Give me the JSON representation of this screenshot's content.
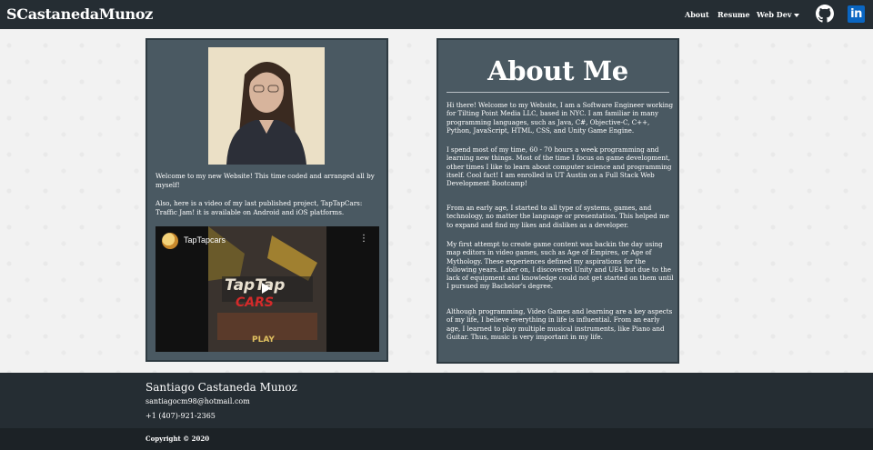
{
  "navbar": {
    "brand": "SCastanedaMunoz",
    "links": [
      "About",
      "Resume",
      "Web Dev"
    ],
    "icons": [
      "github-icon",
      "linkedin-icon"
    ],
    "linkedin_glyph": "in"
  },
  "left_panel": {
    "intro": "Welcome to my new Website! This time coded and arranged all by myself!",
    "project": "Also, here is a video of my last published project, TapTapCars: Traffic Jam! it is available on Android and iOS platforms.",
    "video": {
      "title": "TapTapcars",
      "menu_glyph": "⋮",
      "logo_text_1": "TapTap",
      "logo_text_2": "CARS",
      "play_text": "PLAY"
    }
  },
  "about": {
    "title": "About Me",
    "paragraphs": [
      "Hi there! Welcome to my Website, I am a Software Engineer working for Tilting Point Media LLC, based in NYC. I am familiar in many programming languages, such as Java, C#, Objective-C, C++, Python, JavaScript, HTML, CSS, and Unity Game Engine.",
      "I spend most of my time, 60 - 70 hours a week programming and learning new things. Most of the time I focus on game development, other times I like to learn about computer science and programming itself. Cool fact! I am enrolled in UT Austin on a Full Stack Web Development Bootcamp!",
      "From an early age, I started to all type of systems, games, and technology, no matter the language or presentation. This helped me to expand and find my likes and dislikes as a developer.",
      "My first attempt to create game content was backin the day using map editors in video games, such as Age of Empires, or Age of Mythology. These experiences defined my aspirations for the following years. Later on, I discovered Unity and UE4 but due to the lack of equipment and knowledge could not get started on them until I pursued my Bachelor's degree.",
      "Although programming, Video Games and learning are a key aspects of my life, I believe everything in life is influential. From an early age, I learned to play multiple musical instruments, like Piano and Guitar. Thus, music is very important in my life."
    ]
  },
  "footer": {
    "name": "Santiago Castaneda Munoz",
    "email": "santiagocm98@hotmail.com",
    "phone": "+1 (407)-921-2365",
    "copyright": "Copyright © 2020"
  },
  "colors": {
    "navbar": "#252d33",
    "panel": "#4a5962",
    "footer": "#252d33",
    "linkedin": "#0a66c2"
  }
}
